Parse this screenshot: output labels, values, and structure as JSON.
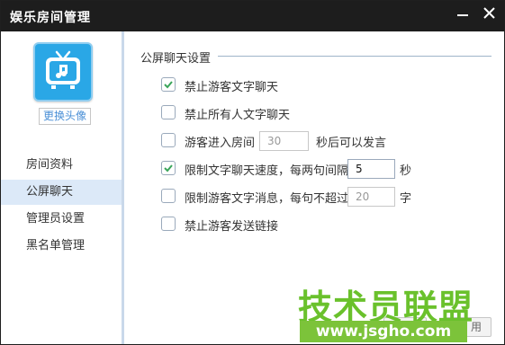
{
  "window": {
    "title": "娱乐房间管理"
  },
  "titlebar": {
    "minimize_icon": "minimize-icon",
    "close_icon": "close-icon"
  },
  "sidebar": {
    "avatar_icon": "music-tv-icon",
    "change_avatar_label": "更换头像",
    "items": [
      {
        "label": "房间资料",
        "active": false
      },
      {
        "label": "公屏聊天",
        "active": true
      },
      {
        "label": "管理员设置",
        "active": false
      },
      {
        "label": "黑名单管理",
        "active": false
      }
    ]
  },
  "main": {
    "section_title": "公屏聊天设置",
    "options": [
      {
        "label": "禁止游客文字聊天",
        "checked": true
      },
      {
        "label": "禁止所有人文字聊天",
        "checked": false
      },
      {
        "label": "游客进入房间",
        "checked": false,
        "value": "30",
        "suffix": "秒后可以发言"
      },
      {
        "label": "限制文字聊天速度，每两句间隔",
        "checked": true,
        "value": "5",
        "suffix": "秒"
      },
      {
        "label": "限制游客文字消息，每句不超过",
        "checked": false,
        "value": "20",
        "suffix": "字"
      },
      {
        "label": "禁止游客发送链接",
        "checked": false
      }
    ]
  },
  "footer": {
    "buttons": [
      "用"
    ]
  },
  "watermark": {
    "text": "技术员联盟",
    "url": "www.jsgho.com"
  },
  "colors": {
    "titlebar": "#1d1d1d",
    "accent": "#2aa7e6",
    "active_nav": "#dce9f8",
    "check": "#3aa55a",
    "watermark": "#6ac12c"
  }
}
